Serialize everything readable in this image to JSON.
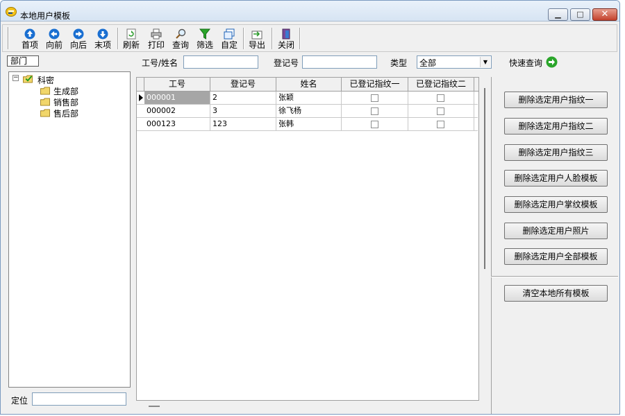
{
  "window": {
    "title": "本地用户模板",
    "minimize": "▁",
    "maximize": "□",
    "close": "✕"
  },
  "toolbar": {
    "first": "首项",
    "prev": "向前",
    "next": "向后",
    "last": "末项",
    "refresh": "刷新",
    "print": "打印",
    "query": "查询",
    "filter": "筛选",
    "custom": "自定",
    "export": "导出",
    "close": "关闭"
  },
  "search": {
    "dept_tab": "部门",
    "id_name_label": "工号/姓名",
    "id_name_value": "",
    "reg_label": "登记号",
    "reg_value": "",
    "type_label": "类型",
    "type_value": "全部",
    "quick_query": "快速查询"
  },
  "tree": {
    "root": "科密",
    "children": [
      "生成部",
      "销售部",
      "售后部"
    ]
  },
  "locate": {
    "label": "定位",
    "value": ""
  },
  "grid": {
    "columns": [
      "工号",
      "登记号",
      "姓名",
      "已登记指纹一",
      "已登记指纹二"
    ],
    "rows": [
      {
        "id": "000001",
        "reg": "2",
        "name": "张颖",
        "fp1": false,
        "fp2": false
      },
      {
        "id": "000002",
        "reg": "3",
        "name": "徐飞杨",
        "fp1": false,
        "fp2": false
      },
      {
        "id": "000123",
        "reg": "123",
        "name": "张韩",
        "fp1": false,
        "fp2": false
      }
    ]
  },
  "actions": {
    "del_fp1": "删除选定用户指纹一",
    "del_fp2": "删除选定用户指纹二",
    "del_fp3": "删除选定用户指纹三",
    "del_face": "删除选定用户人脸模板",
    "del_palm": "删除选定用户掌纹模板",
    "del_photo": "删除选定用户照片",
    "del_all": "删除选定用户全部模板",
    "clear_all": "清空本地所有模板"
  },
  "colors": {
    "accent_blue": "#1a6fd1",
    "go_green": "#2aa52a",
    "folder_yellow": "#f1d66a"
  }
}
